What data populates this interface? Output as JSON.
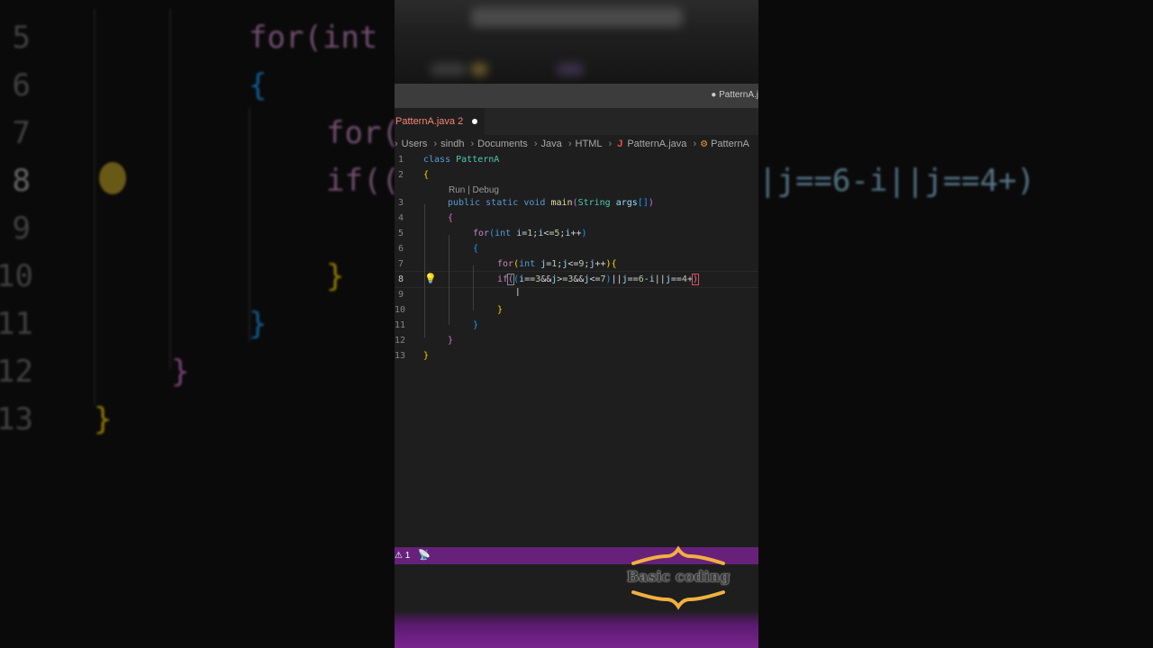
{
  "window": {
    "title": "● PatternA.j"
  },
  "tab": {
    "label": "PatternA.java 2",
    "dirty": true
  },
  "breadcrumb": {
    "items": [
      "Users",
      "sindh",
      "Documents",
      "Java",
      "HTML"
    ],
    "file_icon": "J",
    "file": "PatternA.java",
    "symbol_icon": "symbol-class-icon",
    "symbol": "PatternA"
  },
  "editor": {
    "codelens": "Run | Debug",
    "active_line": 8,
    "line_numbers": [
      "1",
      "2",
      "3",
      "4",
      "5",
      "6",
      "7",
      "8",
      "9",
      "10",
      "11",
      "12",
      "13"
    ],
    "lines": [
      "class PatternA",
      "{",
      "public static void main(String args[])",
      "{",
      "for(int i=1;i<=5;i++)",
      "{",
      "for(int j=1;j<=9;j++){",
      "if((i==3&&j>=3&&j<=7)||j==6-i||j==4+)",
      "",
      "}",
      "}",
      "}",
      "}"
    ]
  },
  "status": {
    "problems": "⚠ 1",
    "live_share_icon": "broadcast-icon"
  },
  "background": {
    "line_numbers": [
      "5",
      "6",
      "7",
      "8",
      "9",
      "10",
      "11",
      "12",
      "13"
    ],
    "code": [
      "for(int",
      "{",
      "for(",
      "if((",
      "|j==6-i||j==4+)",
      "}",
      "}",
      "}",
      "}"
    ]
  },
  "watermark": {
    "text": "Basic coding"
  },
  "colors": {
    "status_bar": "#68217a",
    "editor_bg": "#1e1e1e",
    "tab_error_text": "#f48771",
    "keyword": "#569cd6",
    "bracket_level1": "#ffd700",
    "bracket_level2": "#da70d6",
    "bracket_level3": "#179fff"
  }
}
